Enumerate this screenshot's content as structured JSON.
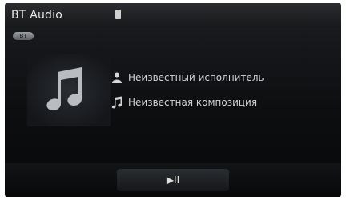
{
  "header": {
    "title": "BT Audio",
    "badge": "BT"
  },
  "track": {
    "artist": "Неизвестный исполнитель",
    "song": "Неизвестная композиция"
  },
  "controls": {
    "play_pause_label": "▶II"
  },
  "icons": {
    "album": "music-note-icon",
    "artist": "person-icon",
    "song": "music-note-icon",
    "device": "phone-icon"
  }
}
